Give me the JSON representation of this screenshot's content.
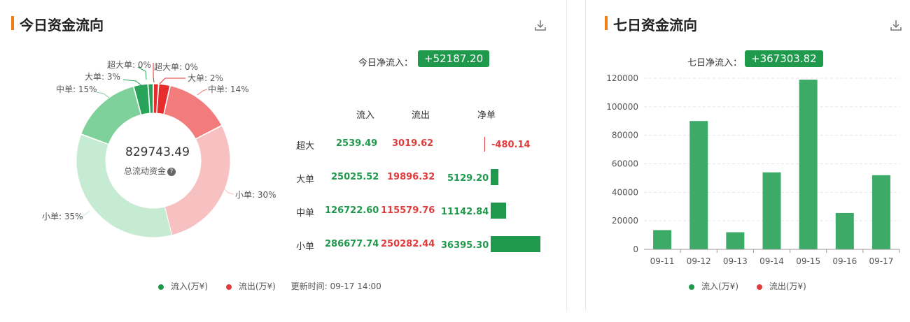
{
  "left": {
    "title": "今日资金流向",
    "net_label": "今日净流入：",
    "net_value": "+52187.20",
    "donut": {
      "center_value": "829743.49",
      "center_label": "总流动资金"
    },
    "table": {
      "headers": [
        "流入",
        "流出",
        "净单"
      ],
      "rows": [
        {
          "label": "超大",
          "inflow": "2539.49",
          "outflow": "3019.62",
          "net": "-480.14"
        },
        {
          "label": "大单",
          "inflow": "25025.52",
          "outflow": "19896.32",
          "net": "5129.20"
        },
        {
          "label": "中单",
          "inflow": "126722.60",
          "outflow": "115579.76",
          "net": "11142.84"
        },
        {
          "label": "小单",
          "inflow": "286677.74",
          "outflow": "250282.44",
          "net": "36395.30"
        }
      ]
    },
    "legend": {
      "inflow": "流入(万¥)",
      "outflow": "流出(万¥)",
      "update": "更新时间: 09-17 14:00"
    }
  },
  "right": {
    "title": "七日资金流向",
    "net_label": "七日净流入：",
    "net_value": "+367303.82",
    "legend": {
      "inflow": "流入(万¥)",
      "outflow": "流出(万¥)"
    }
  },
  "colors": {
    "accent": "#f07d17",
    "green": "#1f9a4c",
    "red": "#e23b3b",
    "bar_green": "#3daa67"
  },
  "chart_data": [
    {
      "type": "pie",
      "slices": [
        {
          "label": "超大单: 0%",
          "value": 2539.49,
          "color": "#27a35a"
        },
        {
          "label": "大单: 3%",
          "value": 25025.52,
          "color": "#27a35a"
        },
        {
          "label": "中单: 15%",
          "value": 126722.6,
          "color": "#7fd19b"
        },
        {
          "label": "小单: 35%",
          "value": 286677.74,
          "color": "#c6ebd3"
        },
        {
          "label": "小单: 30%",
          "value": 250282.44,
          "color": "#f8c1c1"
        },
        {
          "label": "中单: 14%",
          "value": 115579.76,
          "color": "#f27c7c"
        },
        {
          "label": "大单: 2%",
          "value": 19896.32,
          "color": "#e62c2c"
        },
        {
          "label": "超大单: 0%",
          "value": 3019.62,
          "color": "#e62c2c"
        }
      ]
    },
    {
      "type": "bar",
      "categories": [
        "09-11",
        "09-12",
        "09-13",
        "09-14",
        "09-15",
        "09-16",
        "09-17"
      ],
      "values": [
        13500,
        90000,
        12000,
        54000,
        119000,
        25500,
        52000
      ],
      "ylim": [
        0,
        120000
      ],
      "yticks": [
        0,
        20000,
        40000,
        60000,
        80000,
        100000,
        120000
      ],
      "grid": true
    }
  ]
}
